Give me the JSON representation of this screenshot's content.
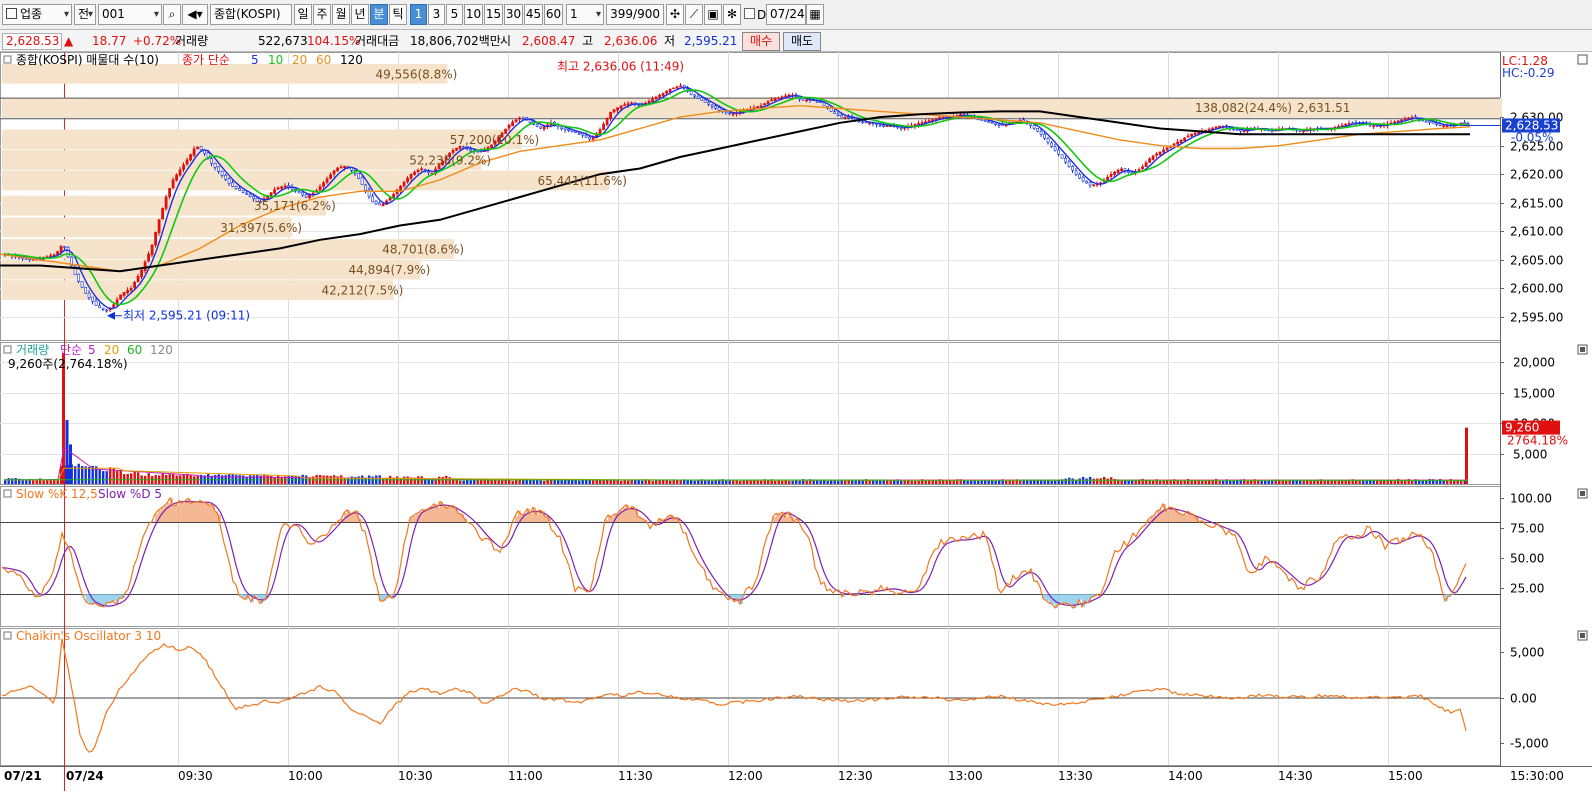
{
  "toolbar": {
    "market_select": "업종",
    "type_select": "전",
    "code": "001",
    "name": "종합(KOSPI)",
    "periods": [
      "일",
      "주",
      "월",
      "년",
      "분",
      "틱"
    ],
    "active_period": "분",
    "intervals": [
      "1",
      "3",
      "5",
      "10",
      "15",
      "30",
      "45",
      "60"
    ],
    "active_interval": "1",
    "interval_input": "1",
    "count_display": "399/900",
    "date_value": "07/24",
    "date_checkbox_label": "D"
  },
  "infobar": {
    "price": "2,628.53",
    "change_arrow": "▲",
    "change": "18.77",
    "change_pct": "+0.72%",
    "volume_label": "거래량",
    "volume": "522,673",
    "volume_ratio": "104.15%",
    "amount_label": "거래대금",
    "amount": "18,806,702백만",
    "open_label": "시",
    "open": "2,608.47",
    "high_label": "고",
    "high": "2,636.06",
    "low_label": "저",
    "low": "2,595.21",
    "buy_button": "매수",
    "sell_button": "매도"
  },
  "colors": {
    "up": "#e01010",
    "down": "#1030e0",
    "ma5": "#1a2fe0",
    "ma10": "#12c812",
    "ma20": "#f08c1a",
    "ma60": "#000000",
    "profile": "#f5e3cc",
    "profile_text": "#7a5020",
    "stoch_k": "#f07820",
    "stoch_d": "#8020b0",
    "chaikin": "#f07820"
  },
  "chart_data": [
    {
      "type": "line",
      "title": "종합(KOSPI) 매물대 수(10)",
      "subtitle": "종가 단순",
      "legend": [
        "5",
        "10",
        "20",
        "60",
        "120"
      ],
      "lc_label": "LC:1.28",
      "hc_label": "HC:-0.29",
      "ylim": [
        2592,
        2640
      ],
      "y_ticks": [
        "2,630.00",
        "2,625.00",
        "2,620.00",
        "2,615.00",
        "2,610.00",
        "2,605.00",
        "2,600.00",
        "2,595.00"
      ],
      "y_tick_values": [
        2630,
        2625,
        2620,
        2615,
        2610,
        2605,
        2600,
        2595
      ],
      "current_price": 2628.53,
      "current_price_label": "2,628.53",
      "current_change_label": "-0.05%",
      "high_annotation": "최고 2,636.06 (11:49)",
      "low_annotation": "최저 2,595.21 (09:11)",
      "volume_profile": [
        {
          "price": 2637.5,
          "label": "49,556(8.8%)",
          "width": 0.33
        },
        {
          "price": 2631.6,
          "label": "138,082(24.4%)",
          "width": 1.0
        },
        {
          "price": 2626.0,
          "label": "57,200(10.1%)",
          "width": 0.385
        },
        {
          "price": 2622.4,
          "label": "52,238(9.2%)",
          "width": 0.355
        },
        {
          "price": 2618.8,
          "label": "65,441(11.6%)",
          "width": 0.45
        },
        {
          "price": 2614.4,
          "label": "35,171(6.2%)",
          "width": 0.24
        },
        {
          "price": 2610.6,
          "label": "31,397(5.6%)",
          "width": 0.215
        },
        {
          "price": 2606.8,
          "label": "48,701(8.6%)",
          "width": 0.335
        },
        {
          "price": 2603.2,
          "label": "44,894(7.9%)",
          "width": 0.31
        },
        {
          "price": 2599.6,
          "label": "42,212(7.5%)",
          "width": 0.29
        }
      ],
      "profile_extra_label": "2,631.51",
      "price_points": [
        [
          0,
          2606
        ],
        [
          15,
          2605.5
        ],
        [
          30,
          2605
        ],
        [
          45,
          2605.5
        ],
        [
          55,
          2606
        ],
        [
          62,
          2608
        ],
        [
          68,
          2605
        ],
        [
          75,
          2602
        ],
        [
          85,
          2599
        ],
        [
          95,
          2597
        ],
        [
          105,
          2596
        ],
        [
          112,
          2597
        ],
        [
          120,
          2599
        ],
        [
          130,
          2600
        ],
        [
          140,
          2603
        ],
        [
          150,
          2607
        ],
        [
          158,
          2612
        ],
        [
          165,
          2616
        ],
        [
          172,
          2619
        ],
        [
          180,
          2621
        ],
        [
          188,
          2623
        ],
        [
          195,
          2625
        ],
        [
          202,
          2624
        ],
        [
          210,
          2622
        ],
        [
          220,
          2620
        ],
        [
          230,
          2618
        ],
        [
          240,
          2617
        ],
        [
          250,
          2616
        ],
        [
          258,
          2615
        ],
        [
          265,
          2616
        ],
        [
          275,
          2617.5
        ],
        [
          285,
          2618
        ],
        [
          295,
          2617
        ],
        [
          305,
          2616
        ],
        [
          315,
          2617
        ],
        [
          325,
          2619
        ],
        [
          335,
          2621
        ],
        [
          345,
          2621.5
        ],
        [
          355,
          2620
        ],
        [
          365,
          2617
        ],
        [
          372,
          2615
        ],
        [
          380,
          2614.5
        ],
        [
          390,
          2616
        ],
        [
          400,
          2618
        ],
        [
          410,
          2620
        ],
        [
          420,
          2621
        ],
        [
          430,
          2620
        ],
        [
          440,
          2622
        ],
        [
          450,
          2624
        ],
        [
          460,
          2625
        ],
        [
          470,
          2624
        ],
        [
          480,
          2624
        ],
        [
          490,
          2625
        ],
        [
          500,
          2627
        ],
        [
          510,
          2629
        ],
        [
          520,
          2630
        ],
        [
          530,
          2629
        ],
        [
          540,
          2628
        ],
        [
          550,
          2629
        ],
        [
          560,
          2628
        ],
        [
          570,
          2627.5
        ],
        [
          580,
          2627
        ],
        [
          590,
          2626
        ],
        [
          600,
          2628
        ],
        [
          610,
          2631
        ],
        [
          620,
          2632
        ],
        [
          630,
          2632.5
        ],
        [
          640,
          2632
        ],
        [
          650,
          2633
        ],
        [
          660,
          2634
        ],
        [
          670,
          2635
        ],
        [
          680,
          2635.5
        ],
        [
          690,
          2634
        ],
        [
          700,
          2633
        ],
        [
          710,
          2632
        ],
        [
          720,
          2631
        ],
        [
          730,
          2630.5
        ],
        [
          740,
          2631
        ],
        [
          750,
          2631.5
        ],
        [
          760,
          2632
        ],
        [
          770,
          2633
        ],
        [
          780,
          2633.5
        ],
        [
          790,
          2634
        ],
        [
          800,
          2633
        ],
        [
          810,
          2633
        ],
        [
          820,
          2632.5
        ],
        [
          830,
          2631
        ],
        [
          840,
          2630
        ],
        [
          850,
          2630
        ],
        [
          860,
          2629
        ],
        [
          870,
          2629
        ],
        [
          880,
          2628.5
        ],
        [
          890,
          2628.5
        ],
        [
          900,
          2628
        ],
        [
          910,
          2628.5
        ],
        [
          920,
          2629
        ],
        [
          930,
          2629.5
        ],
        [
          940,
          2630
        ],
        [
          950,
          2630
        ],
        [
          960,
          2630.5
        ],
        [
          970,
          2630
        ],
        [
          980,
          2629.5
        ],
        [
          990,
          2629
        ],
        [
          1000,
          2628.5
        ],
        [
          1010,
          2629
        ],
        [
          1020,
          2629.5
        ],
        [
          1030,
          2628.5
        ],
        [
          1040,
          2627
        ],
        [
          1050,
          2625
        ],
        [
          1060,
          2623
        ],
        [
          1070,
          2621
        ],
        [
          1080,
          2619
        ],
        [
          1090,
          2618
        ],
        [
          1100,
          2618.5
        ],
        [
          1110,
          2620
        ],
        [
          1120,
          2621
        ],
        [
          1130,
          2620
        ],
        [
          1140,
          2621
        ],
        [
          1150,
          2623
        ],
        [
          1160,
          2624
        ],
        [
          1170,
          2625
        ],
        [
          1180,
          2626
        ],
        [
          1190,
          2627
        ],
        [
          1200,
          2627.5
        ],
        [
          1210,
          2628
        ],
        [
          1220,
          2628.5
        ],
        [
          1230,
          2628
        ],
        [
          1240,
          2627.5
        ],
        [
          1250,
          2628
        ],
        [
          1260,
          2628
        ],
        [
          1270,
          2627.5
        ],
        [
          1280,
          2628
        ],
        [
          1290,
          2628
        ],
        [
          1300,
          2627.5
        ],
        [
          1310,
          2628
        ],
        [
          1320,
          2628
        ],
        [
          1330,
          2628
        ],
        [
          1340,
          2628.5
        ],
        [
          1350,
          2629
        ],
        [
          1360,
          2629
        ],
        [
          1370,
          2628.5
        ],
        [
          1380,
          2628.5
        ],
        [
          1390,
          2629
        ],
        [
          1400,
          2629.5
        ],
        [
          1410,
          2630
        ],
        [
          1420,
          2629.5
        ],
        [
          1430,
          2629
        ],
        [
          1440,
          2628.5
        ],
        [
          1450,
          2628.5
        ],
        [
          1460,
          2629
        ],
        [
          1470,
          2628.53
        ]
      ],
      "ma_points": {
        "ma20": [
          [
            0,
            2606
          ],
          [
            40,
            2605
          ],
          [
            80,
            2604
          ],
          [
            120,
            2603
          ],
          [
            160,
            2604
          ],
          [
            200,
            2607
          ],
          [
            240,
            2611
          ],
          [
            280,
            2614
          ],
          [
            320,
            2616
          ],
          [
            360,
            2617
          ],
          [
            400,
            2617
          ],
          [
            440,
            2619
          ],
          [
            480,
            2622
          ],
          [
            520,
            2624
          ],
          [
            560,
            2625
          ],
          [
            600,
            2626
          ],
          [
            640,
            2628
          ],
          [
            680,
            2630
          ],
          [
            720,
            2631
          ],
          [
            760,
            2631.5
          ],
          [
            800,
            2632
          ],
          [
            840,
            2631.5
          ],
          [
            880,
            2631
          ],
          [
            920,
            2630.5
          ],
          [
            960,
            2630
          ],
          [
            1000,
            2629.5
          ],
          [
            1040,
            2629
          ],
          [
            1080,
            2627.5
          ],
          [
            1120,
            2626
          ],
          [
            1160,
            2625
          ],
          [
            1200,
            2624.5
          ],
          [
            1240,
            2624.5
          ],
          [
            1280,
            2625
          ],
          [
            1320,
            2626
          ],
          [
            1360,
            2627
          ],
          [
            1400,
            2627.5
          ],
          [
            1440,
            2628
          ],
          [
            1470,
            2628.3
          ]
        ],
        "ma60": [
          [
            0,
            2604
          ],
          [
            40,
            2604
          ],
          [
            80,
            2603.5
          ],
          [
            120,
            2603
          ],
          [
            160,
            2604
          ],
          [
            200,
            2605
          ],
          [
            240,
            2606
          ],
          [
            280,
            2607
          ],
          [
            320,
            2608.5
          ],
          [
            360,
            2609.5
          ],
          [
            400,
            2611
          ],
          [
            440,
            2612
          ],
          [
            480,
            2614
          ],
          [
            520,
            2616
          ],
          [
            560,
            2618
          ],
          [
            600,
            2620
          ],
          [
            640,
            2621
          ],
          [
            680,
            2623
          ],
          [
            720,
            2624.5
          ],
          [
            760,
            2626
          ],
          [
            800,
            2627.5
          ],
          [
            840,
            2629
          ],
          [
            880,
            2630
          ],
          [
            920,
            2630.5
          ],
          [
            960,
            2630.8
          ],
          [
            1000,
            2631
          ],
          [
            1040,
            2631
          ],
          [
            1080,
            2630
          ],
          [
            1120,
            2629
          ],
          [
            1160,
            2628
          ],
          [
            1200,
            2627.5
          ],
          [
            1240,
            2627
          ],
          [
            1280,
            2627
          ],
          [
            1320,
            2627
          ],
          [
            1360,
            2627
          ],
          [
            1400,
            2627
          ],
          [
            1440,
            2627
          ],
          [
            1470,
            2627
          ]
        ]
      }
    },
    {
      "type": "bar",
      "title": "거래량",
      "subtitle": "단순",
      "legend": [
        "5",
        "20",
        "60",
        "120"
      ],
      "info": "9,260주(2,764.18%)",
      "ylim": [
        0,
        22000
      ],
      "y_ticks": [
        "20,000",
        "15,000",
        "10,000",
        "5,000"
      ],
      "y_tick_values": [
        20000,
        15000,
        10000,
        5000
      ],
      "current_label": "9,260",
      "current_pct_label": "2764.18%",
      "current_value": 9260,
      "spike_value": 21500,
      "spike_x": 62
    },
    {
      "type": "line",
      "title": "Slow %K 12,5",
      "subtitle": "Slow %D 5",
      "ylim": [
        0,
        100
      ],
      "y_ticks": [
        "100.00",
        "75.00",
        "50.00",
        "25.00"
      ],
      "y_tick_values": [
        100,
        75,
        50,
        25
      ],
      "upper_level": 80,
      "lower_level": 20
    },
    {
      "type": "line",
      "title": "Chaikin's Oscillator 3 10",
      "ylim": [
        -7000,
        7000
      ],
      "y_ticks": [
        "5,000",
        "0.00",
        "-5,000"
      ],
      "y_tick_values": [
        5000,
        0,
        -5000
      ]
    }
  ],
  "x_axis": {
    "labels": [
      {
        "t": "07/21",
        "bold": true
      },
      {
        "t": "07/24",
        "bold": true
      },
      {
        "t": "09:30"
      },
      {
        "t": "10:00"
      },
      {
        "t": "10:30"
      },
      {
        "t": "11:00"
      },
      {
        "t": "11:30"
      },
      {
        "t": "12:00"
      },
      {
        "t": "12:30"
      },
      {
        "t": "13:00"
      },
      {
        "t": "13:30"
      },
      {
        "t": "14:00"
      },
      {
        "t": "14:30"
      },
      {
        "t": "15:00"
      }
    ],
    "right_label": "15:30:00"
  }
}
